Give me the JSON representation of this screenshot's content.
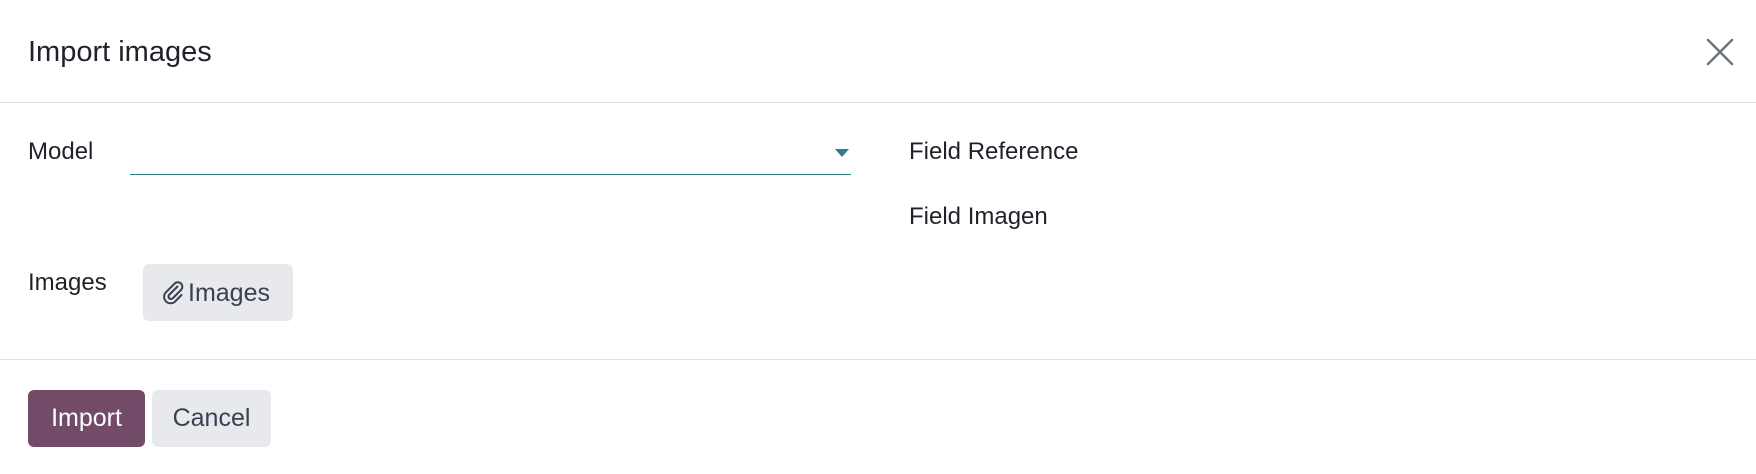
{
  "dialog": {
    "title": "Import images",
    "close_icon": "close-icon"
  },
  "form": {
    "model": {
      "label": "Model",
      "value": ""
    },
    "field_reference": {
      "label": "Field Reference"
    },
    "field_image": {
      "label": "Field Imagen"
    },
    "images": {
      "label": "Images",
      "button_label": "Images",
      "button_icon": "paperclip-icon"
    }
  },
  "footer": {
    "import_label": "Import",
    "cancel_label": "Cancel"
  },
  "colors": {
    "primary": "#714b67",
    "secondary_bg": "#e7e9ed",
    "input_accent": "#2f7d86",
    "divider": "#dee2e6"
  }
}
